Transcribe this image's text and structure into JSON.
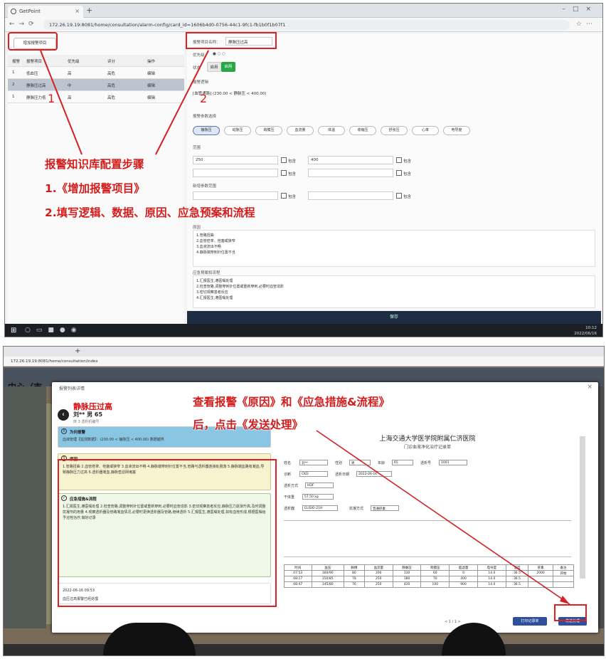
{
  "colors": {
    "annotation_red": "#d41c1c",
    "save_bar": "#1f2d44",
    "green_button": "#28a745",
    "blue_card": "#88c6e3"
  },
  "top_window": {
    "tab_title": "GetPoint",
    "url": "172.26.19.19:8081/home/consultation/alarm-config/card_id=1606b4d0-0756-44c1-9fc1-fb1b0f1b07f1",
    "left": {
      "add_button": "增加报警项目",
      "columns": [
        "报警",
        "报警项目",
        "优先级",
        "评分",
        "操作"
      ],
      "rows": [
        {
          "idx": "1",
          "name": "低血压",
          "level": "高",
          "score": "高危",
          "op": "编辑"
        },
        {
          "idx": "2",
          "name": "静脉压过高",
          "level": "中",
          "score": "高危",
          "op": "编辑"
        },
        {
          "idx": "1",
          "name": "静脉压力低",
          "level": "高",
          "score": "高危",
          "op": "编辑"
        }
      ]
    },
    "right": {
      "name_label": "报警项目名称：",
      "name_value": "静脉压过高",
      "level_label": "优先级",
      "status_label": "状态",
      "status_btn_off": "启用",
      "status_btn_on": "启用",
      "logic_label": "报警逻辑",
      "logic_value": "[血管通路] (230.00 < 静脉压 < 400.00)",
      "data_label": "报警参数选择",
      "chips": [
        "静脉压",
        "动脉压",
        "跨膜压",
        "血流量",
        "体温",
        "收缩压",
        "舒张压",
        "心率",
        "电导度"
      ],
      "range_label": "范围",
      "range_from": "250",
      "range_to": "400",
      "chk_contain": "包含",
      "blank_label": "新增参数范围",
      "cause_label": "原因",
      "cause_lines": [
        "1.管路扭曲",
        "2.血管痉挛、栓塞或狭窄",
        "3.血液流出不畅",
        "4.静脉端穿刺针位置不当"
      ],
      "plan_label": "应急预案和流程",
      "plan_lines": [
        "1.汇报医生,遵医嘱处理",
        "2.检查管路,调整穿刺针位置或重新穿刺,必要时血管造影",
        "3.密切观察患者反应",
        "4.汇报医生,遵医嘱处理"
      ],
      "save": "保存"
    },
    "taskbar_clock": "10:12\n2022/06/16"
  },
  "annotations": {
    "num1": "1",
    "num2": "2",
    "line1": "报警知识库配置步骤",
    "line2": "1.《增加报警项目》",
    "line3": "2.填写逻辑、数据、原因、应急预案和流程",
    "bottom_line1": "查看报警《原因》和《应急措施&流程》",
    "bottom_line2": "后，点击《发送处理》"
  },
  "bottom_window": {
    "url": "172.26.19.19:8081/home/consultation/index",
    "center_text": "中心（市",
    "modal": {
      "title": "报警列表详情",
      "patient_alarm": "静脉压过高",
      "patient_name": "刘** 男 65",
      "patient_note": "床 3 透析机编号",
      "card_alarm_title": "为何报警",
      "card_alarm_body": "血液管理【监测数据】：(230.00 < 静脉压 < 400.00) 数据越界",
      "card_cause_title": "原因",
      "card_cause_body": "1.管路扭曲 2.血管痉挛、栓塞或狭窄 3.血液流出不畅 4.静脉端穿刺针位置不当,管路与透析器连接处脱落 5.静脉端血路有凝血,导致静脉压力过高 6.透析器凝血,静脉壶滤网堵塞",
      "card_plan_title": "应急措施&流程",
      "card_plan_body": "1.汇报医生,遵医嘱处理 2.检查管路,调整穿刺针位置或重新穿刺,必要时血管造影 3.密切观察患者反应,静脉压力逐渐升高,及时调整抗凝剂的用量 4.观察透析器及管路凝血情况,必要时更换透析器及管路,继续透析 5.汇报医生,遵医嘱处理,如有血栓形成,根据医嘱给予溶栓治疗,做好记录",
      "history_time": "2022-06-16 09:53",
      "history_note": "血压过高报警已经处理",
      "form_title": "上海交通大学医学院附属仁济医院",
      "form_subtitle": "门诊血液净化治疗记录单",
      "form_fields": [
        {
          "label": "姓名",
          "value": "刘**"
        },
        {
          "label": "性别",
          "value": "男"
        },
        {
          "label": "年龄",
          "value": "65"
        },
        {
          "label": "透析号",
          "value": "1001"
        },
        {
          "label": "诊断",
          "value": "CKD"
        },
        {
          "label": "透析日期",
          "value": "2022-06-16"
        },
        {
          "label": "透析方式",
          "value": "HDF"
        },
        {
          "label": "干体重",
          "value": "57.50 kg"
        },
        {
          "label": "透析器",
          "value": "ELISIO-21H"
        },
        {
          "label": "抗凝方式",
          "value": "普通肝素"
        }
      ],
      "footer_pager": "< 1 / 1 >",
      "btn_print": "打印记录单",
      "btn_send": "发送处理"
    }
  },
  "form_table": {
    "headers": [
      "时间",
      "血压",
      "脉搏",
      "血流量",
      "静脉压",
      "跨膜压",
      "超滤量",
      "电导度",
      "温度",
      "肝素",
      "备注"
    ],
    "rows": [
      [
        "07:53",
        "160/90",
        "80",
        "200",
        "130",
        "60",
        "0",
        "14.0",
        "36.5",
        "2000",
        "开始"
      ],
      [
        "08:17",
        "150/85",
        "78",
        "250",
        "180",
        "70",
        "400",
        "14.0",
        "36.5",
        "",
        ""
      ],
      [
        "08:47",
        "145/80",
        "76",
        "250",
        "420",
        "100",
        "900",
        "14.0",
        "36.5",
        "",
        ""
      ]
    ]
  }
}
